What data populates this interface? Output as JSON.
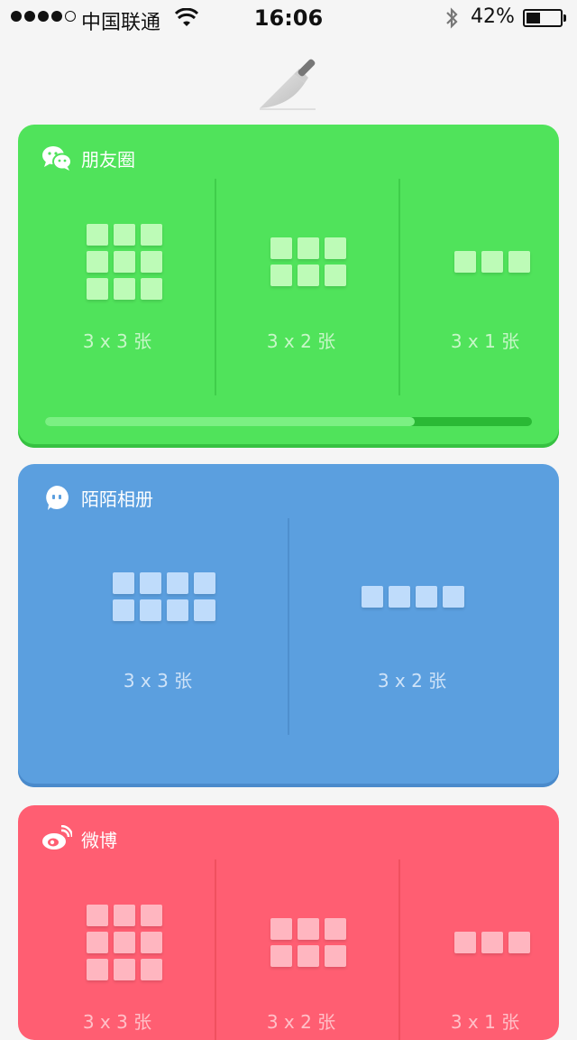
{
  "status_bar": {
    "carrier": "中国联通",
    "time": "16:06",
    "battery_percent": "42%",
    "battery_level": 0.42,
    "signal_strength": 4,
    "signal_max": 5
  },
  "header_icon": "knife-icon",
  "cards": [
    {
      "title": "朋友圈",
      "icon": "wechat-moments-icon",
      "color": "#50e35b",
      "cell_color": "#bdfbb7",
      "options": [
        {
          "label": "3 x 3 张",
          "cols": 3,
          "rows": 3
        },
        {
          "label": "3 x 2 张",
          "cols": 3,
          "rows": 2
        },
        {
          "label": "3 x 1 张",
          "cols": 3,
          "rows": 1
        }
      ],
      "progress": 0.76
    },
    {
      "title": "陌陌相册",
      "icon": "momo-icon",
      "color": "#5b9fdf",
      "cell_color": "#bfdcfb",
      "options": [
        {
          "label": "3 x 3 张",
          "cols": 4,
          "rows": 2
        },
        {
          "label": "3 x 2 张",
          "cols": 4,
          "rows": 1
        }
      ]
    },
    {
      "title": "微博",
      "icon": "weibo-icon",
      "color": "#ff5e72",
      "cell_color": "#ffb6c0",
      "options": [
        {
          "label": "3 x 3 张",
          "cols": 3,
          "rows": 3
        },
        {
          "label": "3 x 2 张",
          "cols": 3,
          "rows": 2
        },
        {
          "label": "3 x 1 张",
          "cols": 3,
          "rows": 1
        }
      ]
    }
  ]
}
